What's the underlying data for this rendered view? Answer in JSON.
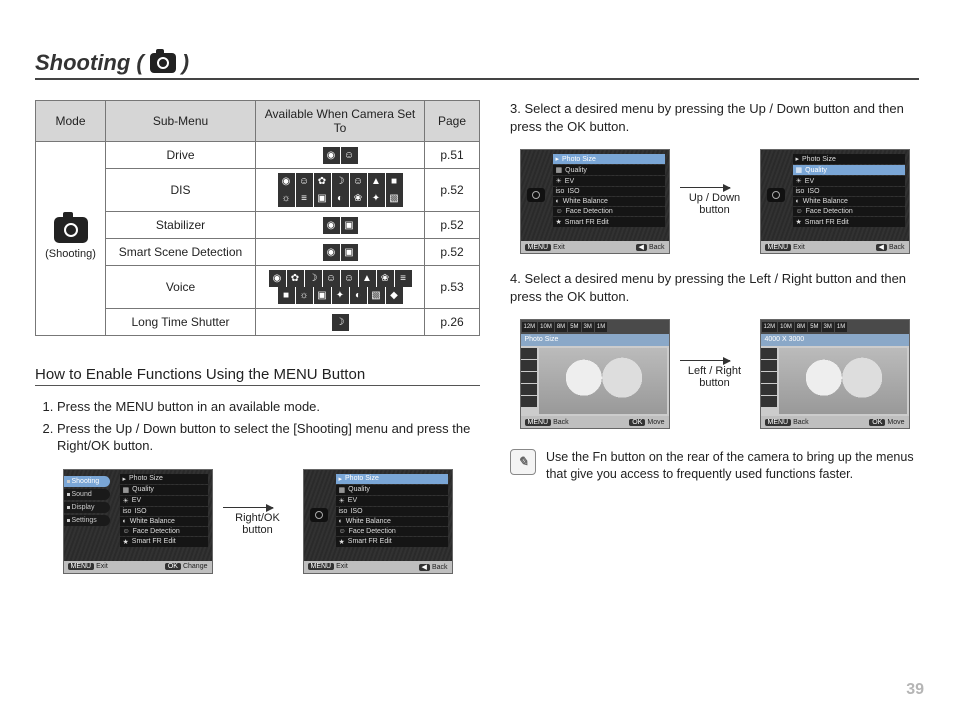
{
  "title": "Shooting (",
  "title_suffix": ")",
  "table": {
    "headers": {
      "mode": "Mode",
      "sub": "Sub-Menu",
      "avail": "Available When Camera Set To",
      "page": "Page"
    },
    "mode_label": "(Shooting)",
    "rows": [
      {
        "sub": "Drive",
        "page": "p.51"
      },
      {
        "sub": "DIS",
        "page": "p.52"
      },
      {
        "sub": "Stabilizer",
        "page": "p.52"
      },
      {
        "sub": "Smart Scene Detection",
        "page": "p.52"
      },
      {
        "sub": "Voice",
        "page": "p.53"
      },
      {
        "sub": "Long Time Shutter",
        "page": "p.26"
      }
    ]
  },
  "subtitle": "How to Enable Functions Using the MENU Button",
  "steps_left": {
    "s1": "Press the MENU button in an available mode.",
    "s2": "Press the Up / Down button to select the [Shooting] menu and press the Right/OK button."
  },
  "caption_left": {
    "a": "Right/OK",
    "b": "button"
  },
  "steps_right": {
    "s3": "3. Select a desired menu by pressing the Up / Down button and then press the OK button.",
    "s4": "4. Select a desired menu by pressing the Left / Right button and then press the OK button."
  },
  "caption_r1": {
    "a": "Up / Down",
    "b": "button"
  },
  "caption_r2": {
    "a": "Left / Right",
    "b": "button"
  },
  "note": "Use the Fn button on the rear of the camera to bring up the menus that give you access to frequently used functions faster.",
  "page_num": "39",
  "menu": {
    "tabs": {
      "shooting": "Shooting",
      "sound": "Sound",
      "display": "Display",
      "settings": "Settings"
    },
    "items": {
      "photo_size": "Photo Size",
      "quality": "Quality",
      "ev": "EV",
      "iso": "ISO",
      "wb": "White Balance",
      "fd": "Face Detection",
      "sfr": "Smart FR Edit"
    },
    "footer": {
      "menu": "MENU",
      "exit": "Exit",
      "change": "Change",
      "ok": "OK",
      "back": "Back",
      "move": "Move"
    },
    "photo_icons": {
      "a": "12M",
      "b": "10M",
      "c": "8M",
      "d": "5M",
      "e": "3M",
      "f": "1M"
    },
    "photo_label": "4000 X 3000"
  }
}
